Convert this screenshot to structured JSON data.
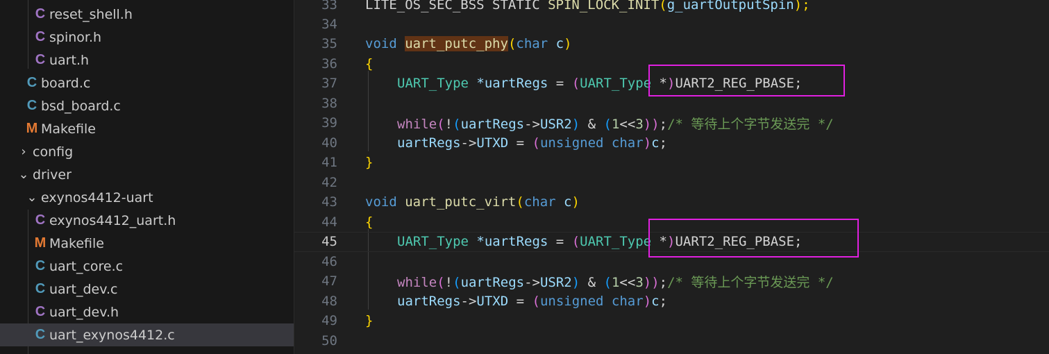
{
  "explorer": {
    "items": [
      {
        "icon": "C",
        "label": "reset_shell.h"
      },
      {
        "icon": "C",
        "label": "spinor.h"
      },
      {
        "icon": "C",
        "label": "uart.h"
      },
      {
        "icon": "C",
        "label": "board.c"
      },
      {
        "icon": "C",
        "label": "bsd_board.c"
      },
      {
        "icon": "M",
        "label": "Makefile"
      },
      {
        "icon": "chevron-right",
        "label": "config"
      },
      {
        "icon": "chevron-down",
        "label": "driver"
      },
      {
        "icon": "chevron-down",
        "label": "exynos4412-uart"
      },
      {
        "icon": "C",
        "label": "exynos4412_uart.h"
      },
      {
        "icon": "M",
        "label": "Makefile"
      },
      {
        "icon": "C",
        "label": "uart_core.c"
      },
      {
        "icon": "C",
        "label": "uart_dev.c"
      },
      {
        "icon": "C",
        "label": "uart_dev.h"
      },
      {
        "icon": "C",
        "label": "uart_exynos4412.c"
      }
    ],
    "selected": "uart_exynos4412.c",
    "colors": {
      "c_header": "#a074c4",
      "c_source": "#519aba",
      "makefile": "#e37933",
      "selection": "#37373d"
    }
  },
  "editor": {
    "active_line": "45",
    "lines": [
      {
        "n": "33",
        "t": {
          "a": "LITE_OS_SEC_BSS STATIC ",
          "b": "SPIN_LOCK_INIT",
          "c": "(",
          "d": "g_uartOutputSpin",
          "e": ");"
        }
      },
      {
        "n": "34"
      },
      {
        "n": "35",
        "t": {
          "kw": "void",
          "fn": "uart_putc_phy",
          "p1": "(",
          "ty": "char",
          "v": "c",
          "p2": ")"
        }
      },
      {
        "n": "36",
        "t": {
          "b": "{"
        }
      },
      {
        "n": "37",
        "t": {
          "ty": "UART_Type",
          "v": "*uartRegs",
          "eq": " = ",
          "p1": "(",
          "ty2": "UART_Type",
          "st": " *",
          "p2": ")",
          "m": "UART2_REG_PBASE",
          "sc": ";"
        }
      },
      {
        "n": "38"
      },
      {
        "n": "39",
        "t": {
          "w": "while",
          "p1": "(",
          "n": "!",
          "p2": "(",
          "v": "uartRegs",
          "ar": "->",
          "f": "USR2",
          "p3": ")",
          "amp": " & ",
          "p4": "(",
          "one": "1",
          "sh": "<<",
          "three": "3",
          "p5": "))",
          "sc": ";",
          "cm": "/* 等待上个字节发送完 */"
        }
      },
      {
        "n": "40",
        "t": {
          "v": "uartRegs",
          "ar": "->",
          "f": "UTXD",
          "eq": " = ",
          "p1": "(",
          "u": "unsigned",
          "ch": "char",
          "p2": ")",
          "c": "c",
          "sc": ";"
        }
      },
      {
        "n": "41",
        "t": {
          "b": "}"
        }
      },
      {
        "n": "42"
      },
      {
        "n": "43",
        "t": {
          "kw": "void",
          "fn": "uart_putc_virt",
          "p1": "(",
          "ty": "char",
          "v": "c",
          "p2": ")"
        }
      },
      {
        "n": "44",
        "t": {
          "b": "{"
        }
      },
      {
        "n": "45",
        "t": {
          "ty": "UART_Type",
          "v": "*uartRegs",
          "eq": " = ",
          "p1": "(",
          "ty2": "UART_Type",
          "st": " *",
          "p2": ")",
          "m": "UART2_REG_PBASE",
          "sc": ";"
        }
      },
      {
        "n": "46"
      },
      {
        "n": "47",
        "t": {
          "w": "while",
          "p1": "(",
          "n": "!",
          "p2": "(",
          "v": "uartRegs",
          "ar": "->",
          "f": "USR2",
          "p3": ")",
          "amp": " & ",
          "p4": "(",
          "one": "1",
          "sh": "<<",
          "three": "3",
          "p5": "))",
          "sc": ";",
          "cm": "/* 等待上个字节发送完 */"
        }
      },
      {
        "n": "48",
        "t": {
          "v": "uartRegs",
          "ar": "->",
          "f": "UTXD",
          "eq": " = ",
          "p1": "(",
          "u": "unsigned",
          "ch": "char",
          "p2": ")",
          "c": "c",
          "sc": ";"
        }
      },
      {
        "n": "49",
        "t": {
          "b": "}"
        }
      },
      {
        "n": "50"
      }
    ],
    "annotation_color": "#e020e0"
  }
}
